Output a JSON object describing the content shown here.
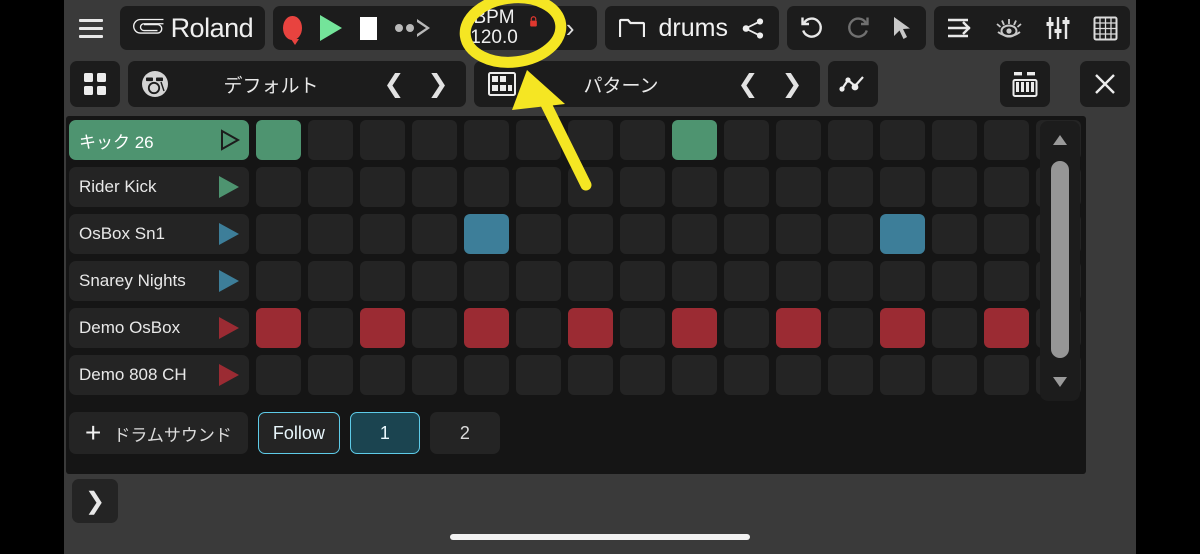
{
  "app": {
    "brand": "Roland",
    "file_name": "drums"
  },
  "toolbar": {
    "menu_icon": "hamburger-menu-icon",
    "record_icon": "record-icon",
    "play_icon": "play-icon",
    "stop_icon": "stop-icon",
    "loop_icon": "dotted-play-icon",
    "bpm_label": "BPM",
    "bpm_value": "120.0",
    "bpm_lock_icon": "lock-icon",
    "bpm_expand_icon": "chevron-right-icon",
    "folder_icon": "folder-icon",
    "share_icon": "share-icon",
    "undo_icon": "undo-icon",
    "redo_icon": "redo-icon",
    "pointer_icon": "pointer-arrow-icon",
    "align_icon": "align-right-arrow-icon",
    "eye_icon": "eye-icon",
    "mixer_icon": "mixer-faders-icon",
    "grid_icon": "grid-icon"
  },
  "subtoolbar": {
    "apps_icon": "four-squares-icon",
    "kit_icon": "drum-kit-icon",
    "kit_name": "デフォルト",
    "prev_icon": "chevron-left-icon",
    "next_icon": "chevron-right-icon",
    "pattern_icon": "pattern-grid-icon",
    "pattern_name": "パターン",
    "automation_icon": "automation-curve-icon",
    "keyboard_icon": "keyboard-icon",
    "close_icon": "close-x-icon"
  },
  "sequencer": {
    "steps": 16,
    "tracks": [
      {
        "name": "キック 26",
        "color": "#4e9470",
        "selected": true,
        "steps": [
          1,
          0,
          0,
          0,
          0,
          0,
          0,
          0,
          1,
          0,
          0,
          0,
          0,
          0,
          0,
          0
        ]
      },
      {
        "name": "Rider Kick",
        "color": "#4e9470",
        "selected": false,
        "steps": [
          0,
          0,
          0,
          0,
          0,
          0,
          0,
          0,
          0,
          0,
          0,
          0,
          0,
          0,
          0,
          0
        ]
      },
      {
        "name": "OsBox Sn1",
        "color": "#3d7e99",
        "selected": false,
        "steps": [
          0,
          0,
          0,
          0,
          1,
          0,
          0,
          0,
          0,
          0,
          0,
          0,
          1,
          0,
          0,
          0
        ]
      },
      {
        "name": "Snarey Nights",
        "color": "#3d7e99",
        "selected": false,
        "steps": [
          0,
          0,
          0,
          0,
          0,
          0,
          0,
          0,
          0,
          0,
          0,
          0,
          0,
          0,
          0,
          0
        ]
      },
      {
        "name": "Demo OsBox",
        "color": "#9b2b33",
        "selected": false,
        "steps": [
          1,
          0,
          1,
          0,
          1,
          0,
          1,
          0,
          1,
          0,
          1,
          0,
          1,
          0,
          1,
          0
        ]
      },
      {
        "name": "Demo 808 CH",
        "color": "#9b2b33",
        "selected": false,
        "steps": [
          0,
          0,
          0,
          0,
          0,
          0,
          0,
          0,
          0,
          0,
          0,
          0,
          0,
          0,
          0,
          0
        ]
      }
    ],
    "empty_cell_color": "#242424",
    "scroll_up_icon": "triangle-up-icon",
    "scroll_down_icon": "triangle-down-icon"
  },
  "bottom": {
    "add_icon": "plus-icon",
    "add_label": "ドラムサウンド",
    "follow_label": "Follow",
    "page_1": "1",
    "page_2": "2",
    "expand_icon": "chevron-right-icon"
  },
  "annotation": {
    "highlight_color": "#f5e623",
    "circle_target": "bpm-field",
    "arrow_direction": "up-left"
  }
}
